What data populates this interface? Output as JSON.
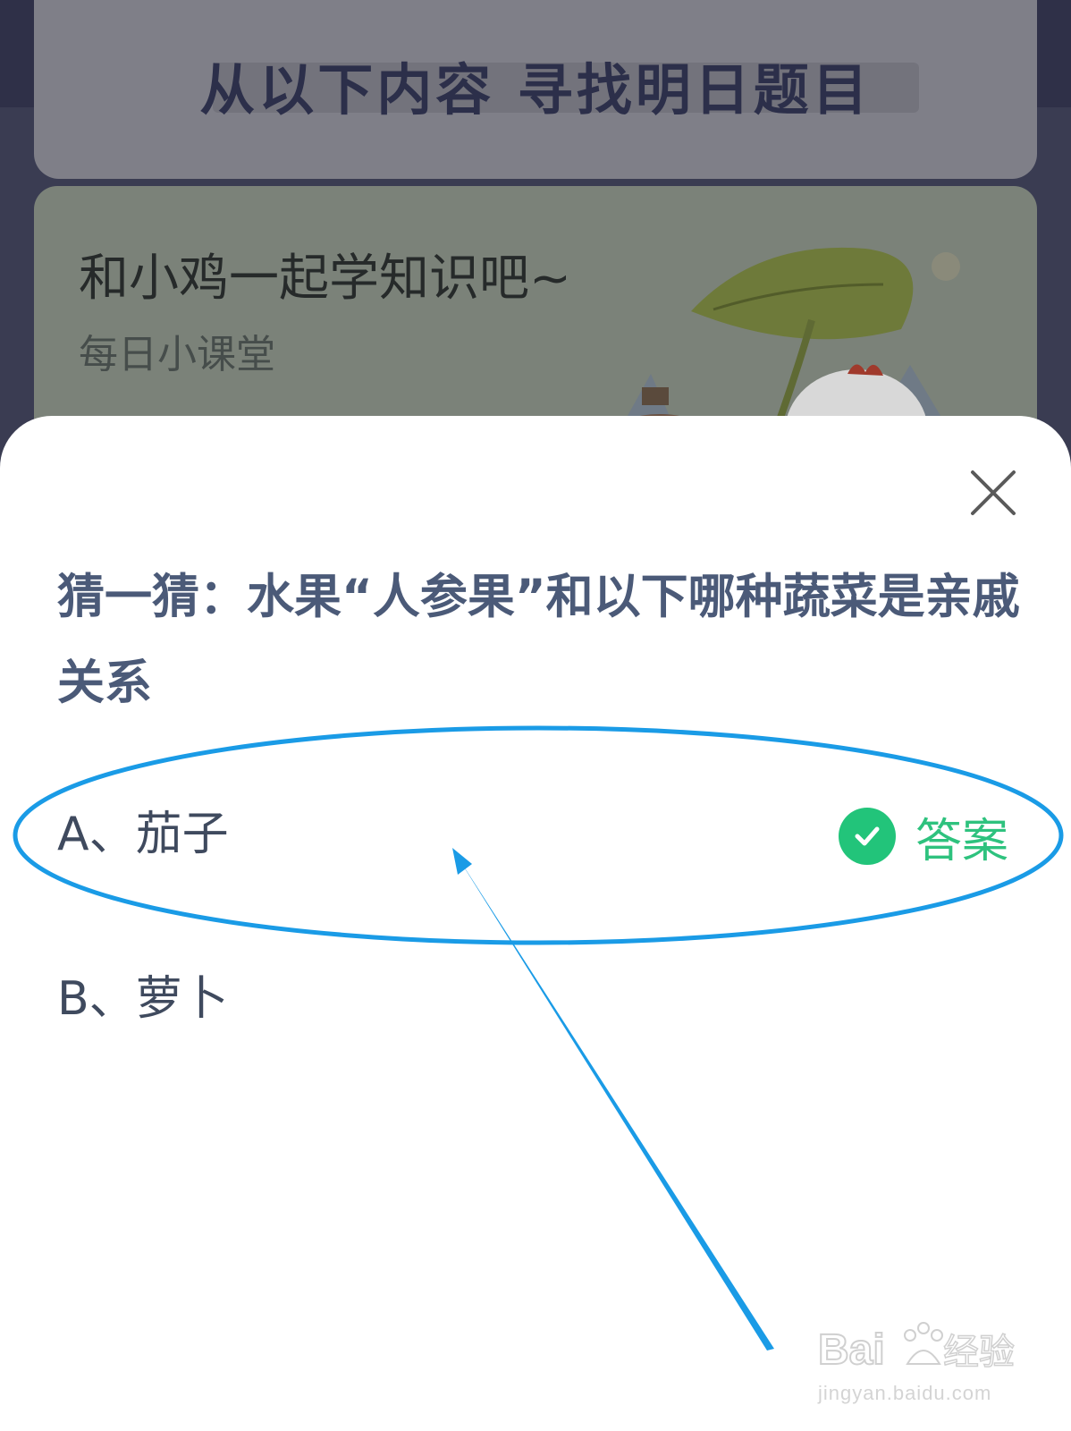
{
  "background": {
    "header_title": "从以下内容  寻找明日题目",
    "banner": {
      "title": "和小鸡一起学知识吧~",
      "subtitle": "每日小课堂"
    }
  },
  "sheet": {
    "question": "猜一猜：水果“人参果”和以下哪种蔬菜是亲戚关系",
    "options": [
      {
        "label": "A、茄子",
        "is_answer": true
      },
      {
        "label": "B、萝卜",
        "is_answer": false
      }
    ],
    "answer_tag": "答案",
    "close_icon": "close-icon",
    "check_icon": "checkmark-circle-icon"
  },
  "watermark": {
    "brand": "Baidu经验",
    "url": "jingyan.baidu.com"
  },
  "colors": {
    "accent_green": "#2ec27e",
    "question_text": "#4b5a78",
    "annotation_blue": "#1a9be6"
  }
}
